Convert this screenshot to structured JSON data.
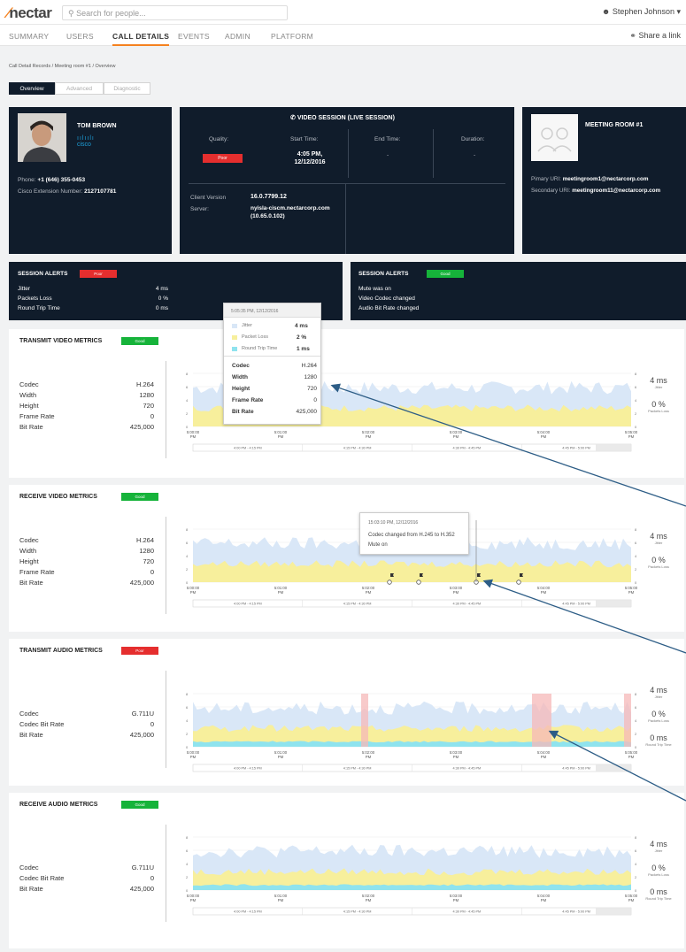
{
  "app": {
    "logo": "nectar",
    "search_placeholder": "Search for people...",
    "user": "Stephen Johnson"
  },
  "nav": {
    "items": [
      "SUMMARY",
      "USERS",
      "CALL DETAILS",
      "EVENTS",
      "ADMIN",
      "PLATFORM"
    ],
    "active": "CALL DETAILS",
    "share": "Share a link"
  },
  "breadcrumb": "Call Detail Records / Meeting room #1 / Overview",
  "tabs": [
    "Overview",
    "Advanced",
    "Diagnostic"
  ],
  "caller": {
    "name": "TOM BROWN",
    "brand": "cisco",
    "phone_label": "Phone:",
    "phone": "+1 (646) 355-0453",
    "ext_label": "Cisco Extension Number:",
    "ext": "2127107781"
  },
  "session": {
    "title": "VIDEO SESSION (LIVE SESSION)",
    "quality_label": "Quality:",
    "quality": "Poor",
    "start_label": "Start Time:",
    "start_time": "4:05 PM,",
    "start_date": "12/12/2016",
    "end_label": "End Time:",
    "end": "-",
    "duration_label": "Duration:",
    "duration": "-",
    "client_label": "Client Version",
    "client": "16.0.7799.12",
    "server_label": "Server:",
    "server_host": "nyisla-ciscm.nectarcorp.com",
    "server_ip": "(10.65.0.102)"
  },
  "room": {
    "title": "MEETING ROOM #1",
    "primary_label": "Pimary URI:",
    "primary": "meetingroom1@nectarcorp.com",
    "secondary_label": "Secondary URI:",
    "secondary": "meetingroom11@nectarcorp.com"
  },
  "alerts_left": {
    "title": "SESSION ALERTS",
    "badge": "Poor",
    "rows": [
      {
        "label": "Jitter",
        "value": "4 ms"
      },
      {
        "label": "Packets Loss",
        "value": "0 %"
      },
      {
        "label": "Round Trip Time",
        "value": "0 ms"
      }
    ]
  },
  "alerts_right": {
    "title": "SESSION ALERTS",
    "badge": "Good",
    "rows": [
      "Mute was on",
      "Video Codec changed",
      "Audio Bit Rate changed"
    ]
  },
  "panels": [
    {
      "title": "TRANSMIT VIDEO METRICS",
      "badge": "Good",
      "metrics": [
        {
          "label": "Codec",
          "value": "H.264"
        },
        {
          "label": "Width",
          "value": "1280"
        },
        {
          "label": "Height",
          "value": "720"
        },
        {
          "label": "Frame Rate",
          "value": "0"
        },
        {
          "label": "Bit Rate",
          "value": "425,000"
        }
      ],
      "right": [
        {
          "big": "4 ms",
          "sm": "Jitter"
        },
        {
          "big": "0 %",
          "sm": "Packets Loss"
        }
      ]
    },
    {
      "title": "RECEIVE VIDEO METRICS",
      "badge": "Good",
      "metrics": [
        {
          "label": "Codec",
          "value": "H.264"
        },
        {
          "label": "Width",
          "value": "1280"
        },
        {
          "label": "Height",
          "value": "720"
        },
        {
          "label": "Frame Rate",
          "value": "0"
        },
        {
          "label": "Bit Rate",
          "value": "425,000"
        }
      ],
      "right": [
        {
          "big": "4 ms",
          "sm": "Jitter"
        },
        {
          "big": "0 %",
          "sm": "Packets Loss"
        }
      ]
    },
    {
      "title": "TRANSMIT AUDIO METRICS",
      "badge": "Poor",
      "metrics": [
        {
          "label": "Codec",
          "value": "G.711U"
        },
        {
          "label": "Codec Bit Rate",
          "value": "0"
        },
        {
          "label": "Bit Rate",
          "value": "425,000"
        }
      ],
      "right": [
        {
          "big": "4 ms",
          "sm": "Jitter"
        },
        {
          "big": "0 %",
          "sm": "Packets Loss"
        },
        {
          "big": "0 ms",
          "sm": "Round Trip Time"
        }
      ]
    },
    {
      "title": "RECEIVE AUDIO METRICS",
      "badge": "Good",
      "metrics": [
        {
          "label": "Codec",
          "value": "G.711U"
        },
        {
          "label": "Codec Bit Rate",
          "value": "0"
        },
        {
          "label": "Bit Rate",
          "value": "425,000"
        }
      ],
      "right": [
        {
          "big": "4 ms",
          "sm": "Jitter"
        },
        {
          "big": "0 %",
          "sm": "Packets Loss"
        },
        {
          "big": "0 ms",
          "sm": "Round Trip Time"
        }
      ]
    }
  ],
  "chart_data": {
    "type": "area",
    "x": [
      "5:00:00 PM",
      "5:01:00 PM",
      "5:02:00 PM",
      "5:03:00 PM",
      "5:04:00 PM",
      "5:05:00 PM"
    ],
    "y_ticks": [
      "0",
      "2",
      "4",
      "6",
      "8"
    ],
    "ylim": [
      0,
      8
    ],
    "ranges": [
      "4:00 PM - 4:15 PM",
      "4:15 PM - 4:30 PM",
      "4:30 PM - 4:45 PM",
      "4:45 PM - 5:00 PM"
    ],
    "series": [
      {
        "name": "Jitter",
        "color": "#d9e7f7"
      },
      {
        "name": "Packet Loss",
        "color": "#f7ef9c"
      },
      {
        "name": "Round Trip Time",
        "color": "#8fe3ee"
      }
    ],
    "colors": {
      "poor_band": "#f6b8b8"
    }
  },
  "tooltip1": {
    "date": "5:05:35 PM, 12/12/2016",
    "legend": [
      {
        "label": "Jitter",
        "value": "4 ms"
      },
      {
        "label": "Packet Loss",
        "value": "2 %"
      },
      {
        "label": "Round Trip Time",
        "value": "1 ms"
      }
    ],
    "rows": [
      {
        "label": "Codec",
        "value": "H.264"
      },
      {
        "label": "Width",
        "value": "1280"
      },
      {
        "label": "Height",
        "value": "720"
      },
      {
        "label": "Frame Rate",
        "value": "0"
      },
      {
        "label": "Bit Rate",
        "value": "425,000"
      }
    ]
  },
  "tooltip2": {
    "date": "15:03:10 PM, 12/12/2016",
    "line1": "Codec changed from H.245 to H.352",
    "line2": "Mute on"
  }
}
